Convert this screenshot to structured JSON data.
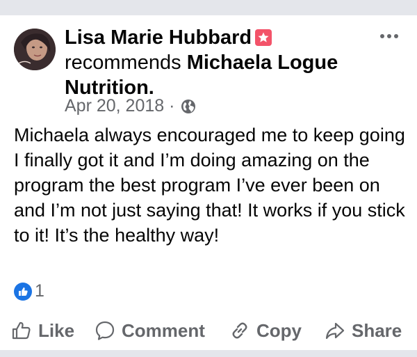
{
  "post": {
    "author": "Lisa Marie Hubbard",
    "action": "recommends",
    "page": "Michaela Logue Nutrition.",
    "date": "Apr 20, 2018",
    "separator": "·",
    "audience_icon": "globe-icon",
    "body": "Michaela always  encouraged me to keep going I finally got it and I’m doing amazing on the program the best program I’ve ever been on and I’m not just saying that! It works if you stick to it! It’s the healthy way!",
    "reaction_count": "1",
    "reaction_icon": "like-reaction-icon"
  },
  "actions": {
    "like": "Like",
    "comment": "Comment",
    "copy": "Copy",
    "share": "Share"
  },
  "colors": {
    "accent_blue": "#1b74e4",
    "badge_pink": "#f35369",
    "secondary_text": "#65676b",
    "divider": "#e4e6eb"
  }
}
